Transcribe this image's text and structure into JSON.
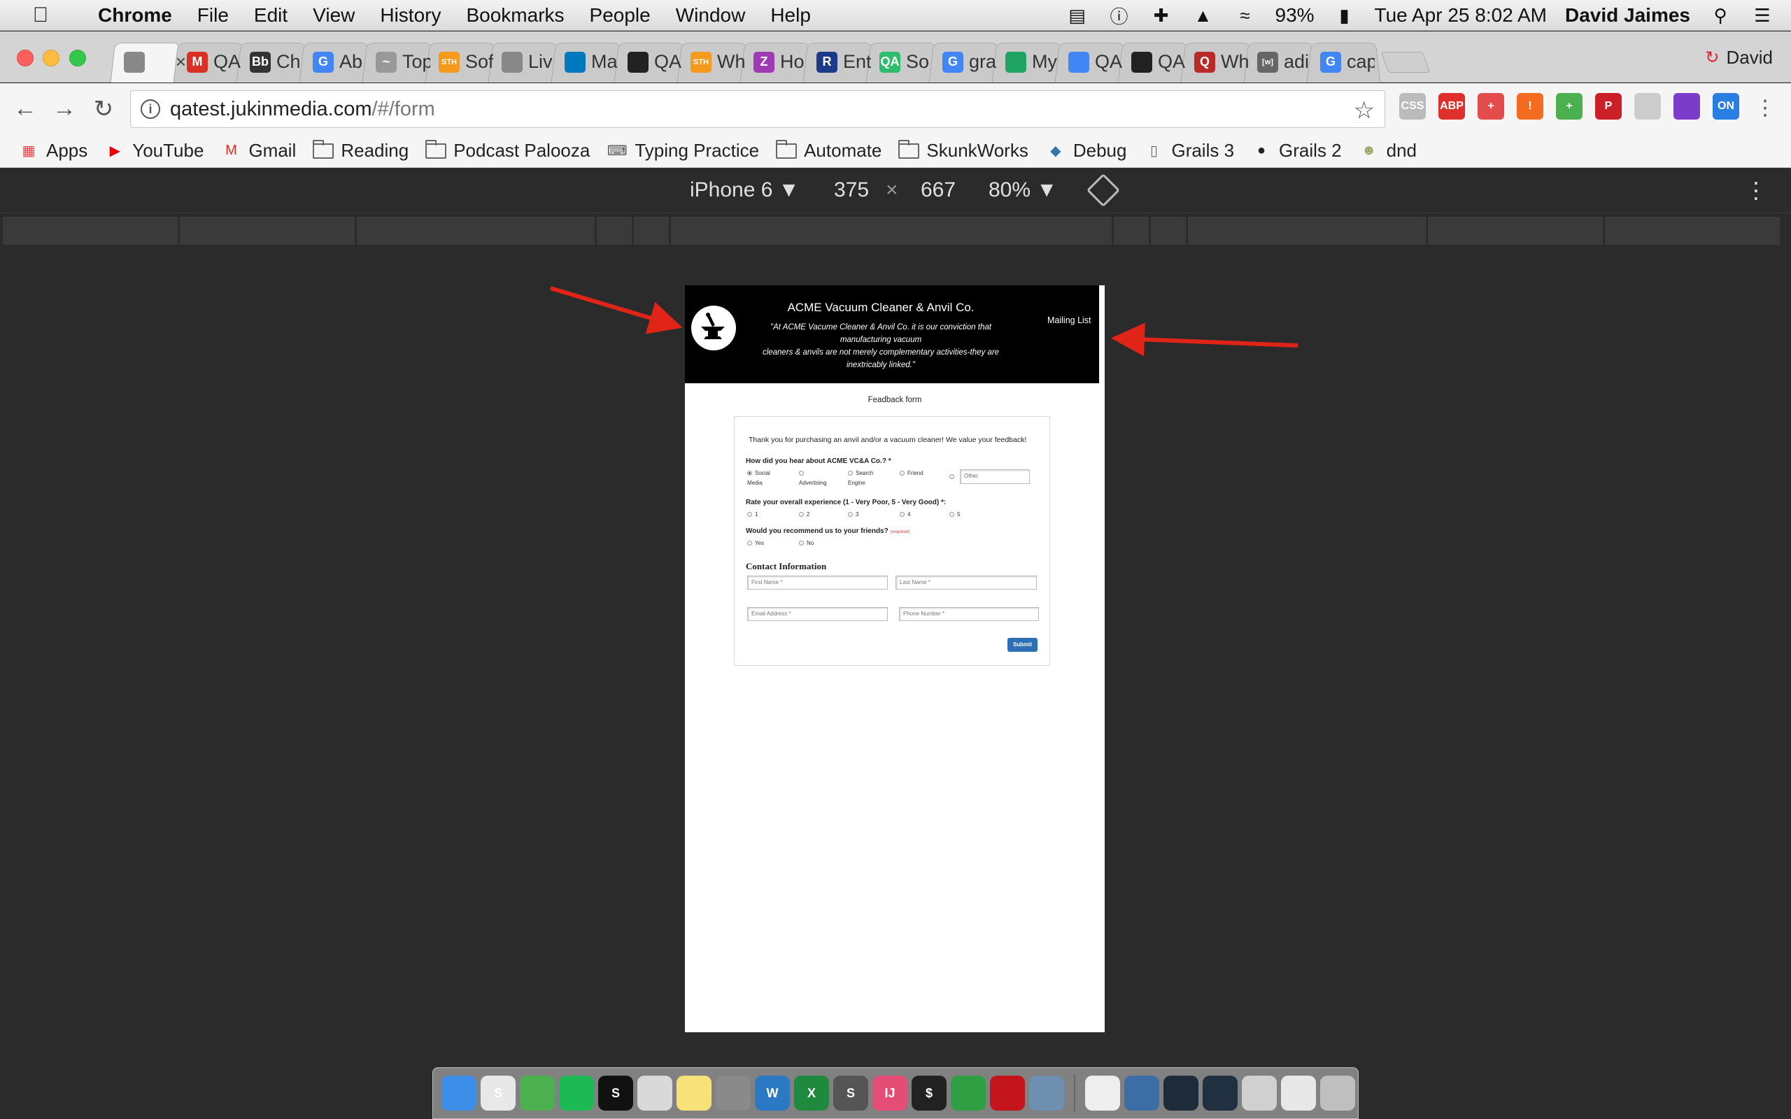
{
  "menubar": {
    "app": "Chrome",
    "items": [
      "File",
      "Edit",
      "View",
      "History",
      "Bookmarks",
      "People",
      "Window",
      "Help"
    ],
    "battery": "93%",
    "datetime": "Tue Apr 25  8:02 AM",
    "user": "David Jaimes"
  },
  "tabs": [
    {
      "title": "",
      "icon": "page-icon",
      "color": "#888888",
      "glyph": "",
      "active": true
    },
    {
      "title": "QA",
      "icon": "gmail-icon",
      "color": "#d93025",
      "glyph": "M"
    },
    {
      "title": "Ch",
      "icon": "blackboard-icon",
      "color": "#333333",
      "glyph": "Bb"
    },
    {
      "title": "Ab",
      "icon": "google-icon",
      "color": "#4285f4",
      "glyph": "G"
    },
    {
      "title": "Top",
      "icon": "hyperdrive-icon",
      "color": "#999999",
      "glyph": "~"
    },
    {
      "title": "Sof",
      "icon": "sth-icon",
      "color": "#f59a1d",
      "glyph": "STH"
    },
    {
      "title": "Liv",
      "icon": "page-icon",
      "color": "#888888",
      "glyph": ""
    },
    {
      "title": "Ma",
      "icon": "trello-icon",
      "color": "#0079bf",
      "glyph": ""
    },
    {
      "title": "QA",
      "icon": "github-icon",
      "color": "#222222",
      "glyph": ""
    },
    {
      "title": "Wh",
      "icon": "sth-icon",
      "color": "#f59a1d",
      "glyph": "STH"
    },
    {
      "title": "Ho",
      "icon": "zendesk-icon",
      "color": "#a03ab3",
      "glyph": "Z"
    },
    {
      "title": "Ent",
      "icon": "rapid-icon",
      "color": "#1b3a8a",
      "glyph": "R"
    },
    {
      "title": "So",
      "icon": "qa-icon",
      "color": "#2ebd6b",
      "glyph": "QA"
    },
    {
      "title": "gra",
      "icon": "google-icon",
      "color": "#4285f4",
      "glyph": "G"
    },
    {
      "title": "My",
      "icon": "drive-icon",
      "color": "#1fa463",
      "glyph": ""
    },
    {
      "title": "QA",
      "icon": "docs-icon",
      "color": "#4285f4",
      "glyph": ""
    },
    {
      "title": "QA",
      "icon": "github-icon",
      "color": "#222222",
      "glyph": ""
    },
    {
      "title": "Wh",
      "icon": "quora-icon",
      "color": "#b92b27",
      "glyph": "Q"
    },
    {
      "title": "adi",
      "icon": "wiki-icon",
      "color": "#666666",
      "glyph": "[w]"
    },
    {
      "title": "cap",
      "icon": "google-icon",
      "color": "#4285f4",
      "glyph": "G"
    }
  ],
  "profile": "David",
  "omnibox": {
    "host": "qatest.jukinmedia.com",
    "path": "/#/form"
  },
  "extensions": [
    {
      "name": "css-viewer-icon",
      "color": "#bbbbbb",
      "glyph": "CSS"
    },
    {
      "name": "adblock-icon",
      "color": "#e0302c",
      "glyph": "ABP"
    },
    {
      "name": "medical-cross-icon",
      "color": "#e44b4b",
      "glyph": "+"
    },
    {
      "name": "alert-icon",
      "color": "#f36c21",
      "glyph": "!"
    },
    {
      "name": "plus-extension-icon",
      "color": "#4caf50",
      "glyph": "+"
    },
    {
      "name": "pinterest-icon",
      "color": "#cb2027",
      "glyph": "P"
    },
    {
      "name": "feather-icon",
      "color": "#cccccc",
      "glyph": ""
    },
    {
      "name": "color-picker-icon",
      "color": "#7a3cc9",
      "glyph": ""
    },
    {
      "name": "on-toggle-icon",
      "color": "#2a7de1",
      "glyph": "ON"
    }
  ],
  "bookmarks": [
    {
      "label": "Apps",
      "icon": "apps-grid-icon"
    },
    {
      "label": "YouTube",
      "icon": "youtube-icon"
    },
    {
      "label": "Gmail",
      "icon": "gmail-icon"
    },
    {
      "label": "Reading",
      "icon": "folder-icon"
    },
    {
      "label": "Podcast Palooza",
      "icon": "folder-icon"
    },
    {
      "label": "Typing Practice",
      "icon": "keyboard-icon"
    },
    {
      "label": "Automate",
      "icon": "folder-icon"
    },
    {
      "label": "SkunkWorks",
      "icon": "folder-icon"
    },
    {
      "label": "Debug",
      "icon": "python-icon"
    },
    {
      "label": "Grails 3",
      "icon": "page-icon"
    },
    {
      "label": "Grails 2",
      "icon": "github-icon"
    },
    {
      "label": "dnd",
      "icon": "dnd-icon"
    }
  ],
  "device": {
    "name": "iPhone 6 ▼",
    "width": "375",
    "times": "×",
    "height": "667",
    "zoom": "80% ▼"
  },
  "site": {
    "title": "ACME Vacuum Cleaner & Anvil Co.",
    "tagline_1": "\"At ACME Vacume Cleaner & Anvil Co. it is our conviction that manufacturing vacuum",
    "tagline_2": "cleaners & anvils are not merely complementary activities-they are inextricably linked.\"",
    "mailing_list": "Mailing List"
  },
  "form": {
    "heading": "Feadback form",
    "thanks": "Thank you for purchasing an anvil and/or a vacuum cleaner! We value your feedback!",
    "q1": "How did you hear about ACME VC&A Co.? *",
    "q1_options": [
      {
        "line1": "Social",
        "line2": "Media",
        "checked": true
      },
      {
        "line1": "",
        "line2": "Advertising",
        "checked": false
      },
      {
        "line1": "Search",
        "line2": "Engine",
        "checked": false
      },
      {
        "line1": "Friend",
        "line2": "",
        "checked": false
      }
    ],
    "q1_other_placeholder": "Other",
    "q2": "Rate your overall experience (1 - Very Poor, 5 - Very Good) *:",
    "q2_options": [
      "1",
      "2",
      "3",
      "4",
      "5"
    ],
    "q3": "Would you recommend us to your friends?",
    "q3_required": "(required)",
    "q3_options": [
      "Yes",
      "No"
    ],
    "contact_heading": "Contact Information",
    "first_name": "First Name *",
    "last_name": "Last Name *",
    "email": "Email Address *",
    "phone": "Phone Number *",
    "submit": "Submit"
  },
  "dock": [
    {
      "name": "finder-icon",
      "color": "#3d8ee8",
      "glyph": ""
    },
    {
      "name": "slack-icon",
      "color": "#e8e8e8",
      "glyph": "S"
    },
    {
      "name": "chrome-icon",
      "color": "#4caf50",
      "glyph": ""
    },
    {
      "name": "spotify-icon",
      "color": "#1db954",
      "glyph": ""
    },
    {
      "name": "sonos-icon",
      "color": "#111111",
      "glyph": "S"
    },
    {
      "name": "preview-icon",
      "color": "#d9d9d9",
      "glyph": ""
    },
    {
      "name": "notes-icon",
      "color": "#f7e27a",
      "glyph": ""
    },
    {
      "name": "system-prefs-icon",
      "color": "#8a8a8a",
      "glyph": ""
    },
    {
      "name": "word-icon",
      "color": "#2b79c2",
      "glyph": "W"
    },
    {
      "name": "excel-icon",
      "color": "#1f8a3d",
      "glyph": "X"
    },
    {
      "name": "sublime-icon",
      "color": "#555555",
      "glyph": "S"
    },
    {
      "name": "intellij-icon",
      "color": "#e34d76",
      "glyph": "IJ"
    },
    {
      "name": "terminal-icon",
      "color": "#222222",
      "glyph": "$"
    },
    {
      "name": "circle-app-icon",
      "color": "#2ea043",
      "glyph": ""
    },
    {
      "name": "acrobat-icon",
      "color": "#c4151c",
      "glyph": ""
    },
    {
      "name": "image-capture-icon",
      "color": "#6f8fb0",
      "glyph": ""
    },
    {
      "name": "document-icon",
      "color": "#eeeeee",
      "glyph": ""
    },
    {
      "name": "downloads-icon",
      "color": "#3a6ea5",
      "glyph": ""
    },
    {
      "name": "screen-window-icon",
      "color": "#1d2b3a",
      "glyph": ""
    },
    {
      "name": "screen-window-icon",
      "color": "#203040",
      "glyph": ""
    },
    {
      "name": "screen-window-icon",
      "color": "#d0d0d0",
      "glyph": ""
    },
    {
      "name": "screen-window-icon",
      "color": "#e8e8e8",
      "glyph": ""
    },
    {
      "name": "trash-icon",
      "color": "#bfbfbf",
      "glyph": ""
    }
  ]
}
